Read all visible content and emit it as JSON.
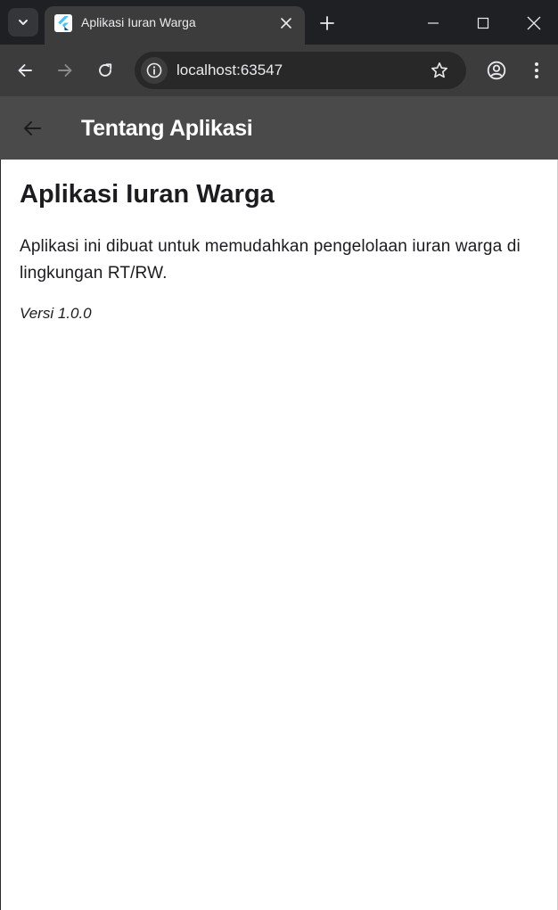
{
  "browser": {
    "tab": {
      "title": "Aplikasi Iuran Warga",
      "favicon": "flutter-icon"
    },
    "address_bar": {
      "url": "localhost:63547"
    },
    "icons": {
      "tab_search": "chevron-down-icon",
      "tab_close": "close-icon",
      "new_tab": "plus-icon",
      "minimize": "minimize-icon",
      "maximize": "maximize-icon",
      "close": "close-icon",
      "back": "arrow-left-icon",
      "forward": "arrow-right-icon",
      "reload": "reload-icon",
      "site_info": "info-icon",
      "bookmark": "star-icon",
      "profile": "account-icon",
      "menu": "more-vertical-icon"
    },
    "colors": {
      "tabstrip": "#1f2023",
      "toolbar": "#3c3c3c",
      "omnibox": "#282828"
    }
  },
  "app": {
    "appbar": {
      "title": "Tentang Aplikasi",
      "back_icon": "arrow-left-icon",
      "color": "#4a4a4a"
    },
    "content": {
      "heading": "Aplikasi Iuran Warga",
      "description": "Aplikasi ini dibuat untuk memudahkan pengelolaan iuran warga di lingkungan RT/RW.",
      "version": "Versi 1.0.0"
    }
  }
}
